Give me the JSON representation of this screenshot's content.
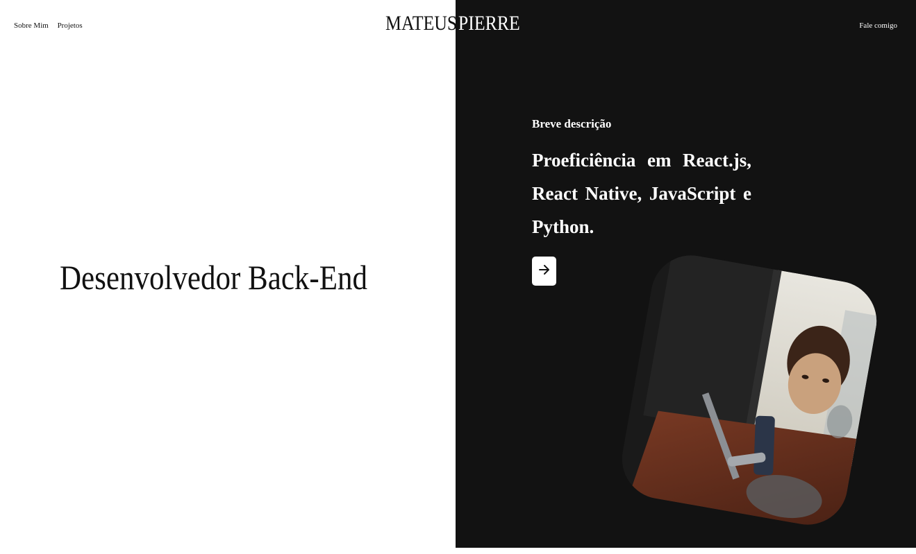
{
  "nav": {
    "links": [
      "Sobre Mim",
      "Projetos"
    ],
    "contact": "Fale comigo"
  },
  "brand": {
    "first": "MATEUS",
    "last": "PIERRE"
  },
  "hero": {
    "title": "Desenvolvedor Back-End"
  },
  "description": {
    "label": "Breve descrição",
    "text": "Proeficiência em React.js, React Native, JavaScript e Python."
  },
  "icons": {
    "arrow": "arrow-right-icon"
  },
  "colors": {
    "left_background": "#ffffff",
    "right_background": "#121212",
    "text_dark": "#111111",
    "text_light": "#ffffff"
  }
}
